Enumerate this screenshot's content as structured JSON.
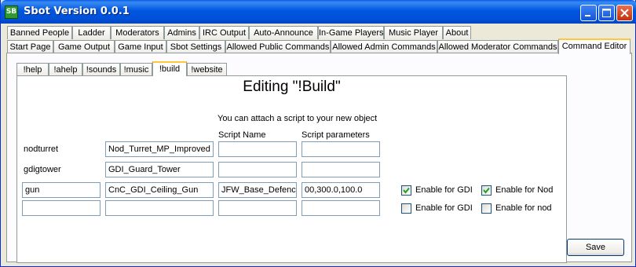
{
  "window": {
    "title": "Sbot Version 0.0.1",
    "app_icon_text": "SB"
  },
  "tabs_row1": [
    "Banned People",
    "Ladder",
    "Moderators",
    "Admins",
    "IRC Output",
    "Auto-Announce",
    "In-Game Players",
    "Music Player",
    "About"
  ],
  "tabs_row2": [
    "Start Page",
    "Game Output",
    "Game Input",
    "Sbot Settings",
    "Allowed Public Commands",
    "Allowed Admin Commands",
    "Allowed Moderator Commands",
    "Command Editor"
  ],
  "active_main_tab": "Command Editor",
  "command_tabs": [
    "!help",
    "!ahelp",
    "!sounds",
    "!music",
    "!build",
    "!website"
  ],
  "active_command_tab": "!build",
  "editor": {
    "heading": "Editing \"!Build\"",
    "hint": "You can attach a script to your new object",
    "col_script_name": "Script Name",
    "col_script_params": "Script parameters",
    "rows": [
      {
        "command": "nodturret",
        "preset": "Nod_Turret_MP_Improved",
        "script_name": "",
        "script_params": ""
      },
      {
        "command": "gdigtower",
        "preset": "GDI_Guard_Tower",
        "script_name": "",
        "script_params": ""
      },
      {
        "command": "gun",
        "preset": "CnC_GDI_Ceiling_Gun",
        "script_name": "JFW_Base_Defenc",
        "script_params": "00,300.0,100.0"
      },
      {
        "command": "",
        "preset": "",
        "script_name": "",
        "script_params": ""
      }
    ],
    "checkboxes": [
      {
        "gdi_label": "Enable for GDI",
        "gdi_checked": true,
        "nod_label": "Enable for Nod",
        "nod_checked": true
      },
      {
        "gdi_label": "Enable for GDI",
        "gdi_checked": false,
        "nod_label": "Enable for nod",
        "nod_checked": false
      }
    ]
  },
  "save_label": "Save"
}
